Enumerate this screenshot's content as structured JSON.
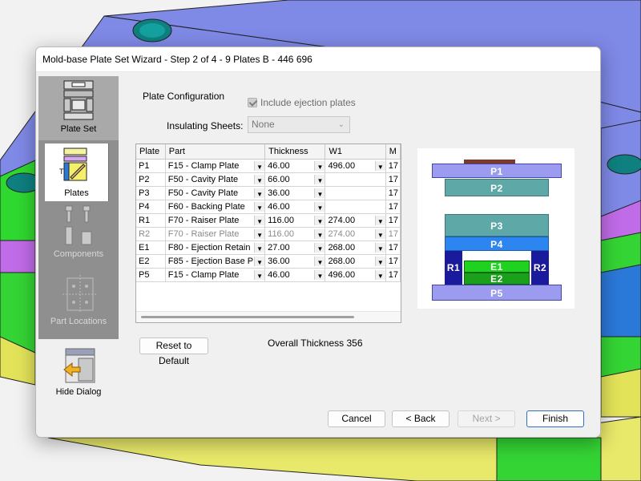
{
  "window": {
    "title": "Mold-base Plate Set Wizard - Step 2 of 4  - 9 Plates B - 446 696"
  },
  "sidebar": {
    "items": [
      {
        "label": "Plate Set",
        "icon": "plate-set-icon"
      },
      {
        "label": "Plates",
        "icon": "plates-icon",
        "selected": true
      },
      {
        "label": "Components",
        "icon": "components-icon",
        "disabled": true
      },
      {
        "label": "Part Locations",
        "icon": "part-locations-icon",
        "disabled": true
      }
    ],
    "hide_dialog": {
      "label": "Hide Dialog",
      "icon": "hide-dialog-icon"
    }
  },
  "config": {
    "section_title": "Plate Configuration",
    "include_ejection_label": "Include ejection plates",
    "include_ejection_checked": true,
    "insulating_label": "Insulating Sheets:",
    "insulating_value": "None"
  },
  "table": {
    "columns": [
      "Plate",
      "Part",
      "Thickness",
      "W1",
      "M"
    ],
    "rows": [
      {
        "plate": "P1",
        "part": "F15 - Clamp Plate",
        "thickness": "46.00",
        "w1": "496.00",
        "extra": "17",
        "disabled": false
      },
      {
        "plate": "P2",
        "part": "F50 - Cavity Plate",
        "thickness": "66.00",
        "w1": "",
        "extra": "17",
        "disabled": false
      },
      {
        "plate": "P3",
        "part": "F50 - Cavity Plate",
        "thickness": "36.00",
        "w1": "",
        "extra": "17",
        "disabled": false
      },
      {
        "plate": "P4",
        "part": "F60 - Backing Plate",
        "thickness": "46.00",
        "w1": "",
        "extra": "17",
        "disabled": false
      },
      {
        "plate": "R1",
        "part": "F70 - Raiser Plate",
        "thickness": "116.00",
        "w1": "274.00",
        "extra": "17",
        "disabled": false
      },
      {
        "plate": "R2",
        "part": "F70 - Raiser Plate",
        "thickness": "116.00",
        "w1": "274.00",
        "extra": "17",
        "disabled": true
      },
      {
        "plate": "E1",
        "part": "F80 - Ejection Retain",
        "thickness": "27.00",
        "w1": "268.00",
        "extra": "17",
        "disabled": false
      },
      {
        "plate": "E2",
        "part": "F85 - Ejection Base P",
        "thickness": "36.00",
        "w1": "268.00",
        "extra": "17",
        "disabled": false
      },
      {
        "plate": "P5",
        "part": "F15 - Clamp Plate",
        "thickness": "46.00",
        "w1": "496.00",
        "extra": "17",
        "disabled": false
      }
    ]
  },
  "actions": {
    "reset_label": "Reset to Default",
    "overall_thickness": "Overall Thickness 356",
    "cancel_label": "Cancel",
    "back_label": "< Back",
    "next_label": "Next >",
    "finish_label": "Finish"
  },
  "diagram": {
    "plates": [
      {
        "label": "P1",
        "color": "#9b9bf0"
      },
      {
        "label": "P2",
        "color": "#5fa8a8"
      },
      {
        "label": "P3",
        "color": "#5fa8a8"
      },
      {
        "label": "P4",
        "color": "#2d86f0"
      },
      {
        "label": "R1",
        "color": "#1a1a9c"
      },
      {
        "label": "R2",
        "color": "#1a1a9c"
      },
      {
        "label": "E1",
        "color": "#1fd21f"
      },
      {
        "label": "E2",
        "color": "#1aa01a"
      },
      {
        "label": "P5",
        "color": "#9b9bf0"
      }
    ],
    "top_sheet_color": "#7a3a2a"
  },
  "colors": {
    "accent": "#2f6fbf",
    "sidebar_bg": "#8f8f8f"
  }
}
